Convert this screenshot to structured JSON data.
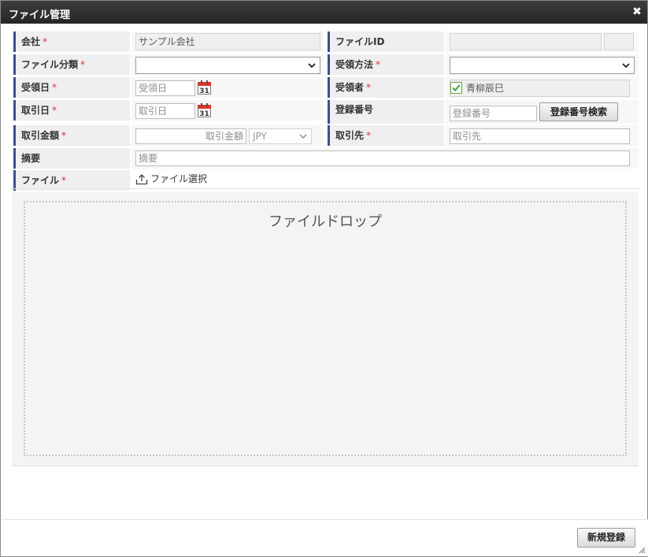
{
  "dialog": {
    "title": "ファイル管理",
    "close_icon": "close-icon"
  },
  "form": {
    "company": {
      "label": "会社",
      "required": "*",
      "value": "サンプル会社"
    },
    "file_id": {
      "label": "ファイルID",
      "value": "",
      "sub_value": ""
    },
    "file_category": {
      "label": "ファイル分類",
      "required": "*",
      "selected": ""
    },
    "receipt_method": {
      "label": "受領方法",
      "required": "*",
      "selected": ""
    },
    "receipt_date": {
      "label": "受領日",
      "required": "*",
      "placeholder": "受領日",
      "icon": "calendar-icon",
      "icon_day": "31"
    },
    "receiver": {
      "label": "受領者",
      "required": "*",
      "value": "青柳辰巳",
      "checked": true
    },
    "transaction_date": {
      "label": "取引日",
      "required": "*",
      "placeholder": "取引日",
      "icon": "calendar-icon",
      "icon_day": "31"
    },
    "registration_number": {
      "label": "登録番号",
      "placeholder": "登録番号",
      "search_button": "登録番号検索"
    },
    "amount": {
      "label": "取引金額",
      "required": "*",
      "placeholder": "取引金額",
      "currency": "JPY"
    },
    "counterparty": {
      "label": "取引先",
      "required": "*",
      "placeholder": "取引先"
    },
    "summary": {
      "label": "摘要",
      "placeholder": "摘要"
    },
    "file": {
      "label": "ファイル",
      "required": "*",
      "select_label": "ファイル選択",
      "icon": "upload-icon"
    }
  },
  "dropzone": {
    "text": "ファイルドロップ"
  },
  "footer": {
    "register_button": "新規登録"
  },
  "colors": {
    "accent_bar": "#3b4f8c",
    "required": "#d9363e",
    "check": "#3fa83a",
    "calendar": "#d9362b"
  }
}
